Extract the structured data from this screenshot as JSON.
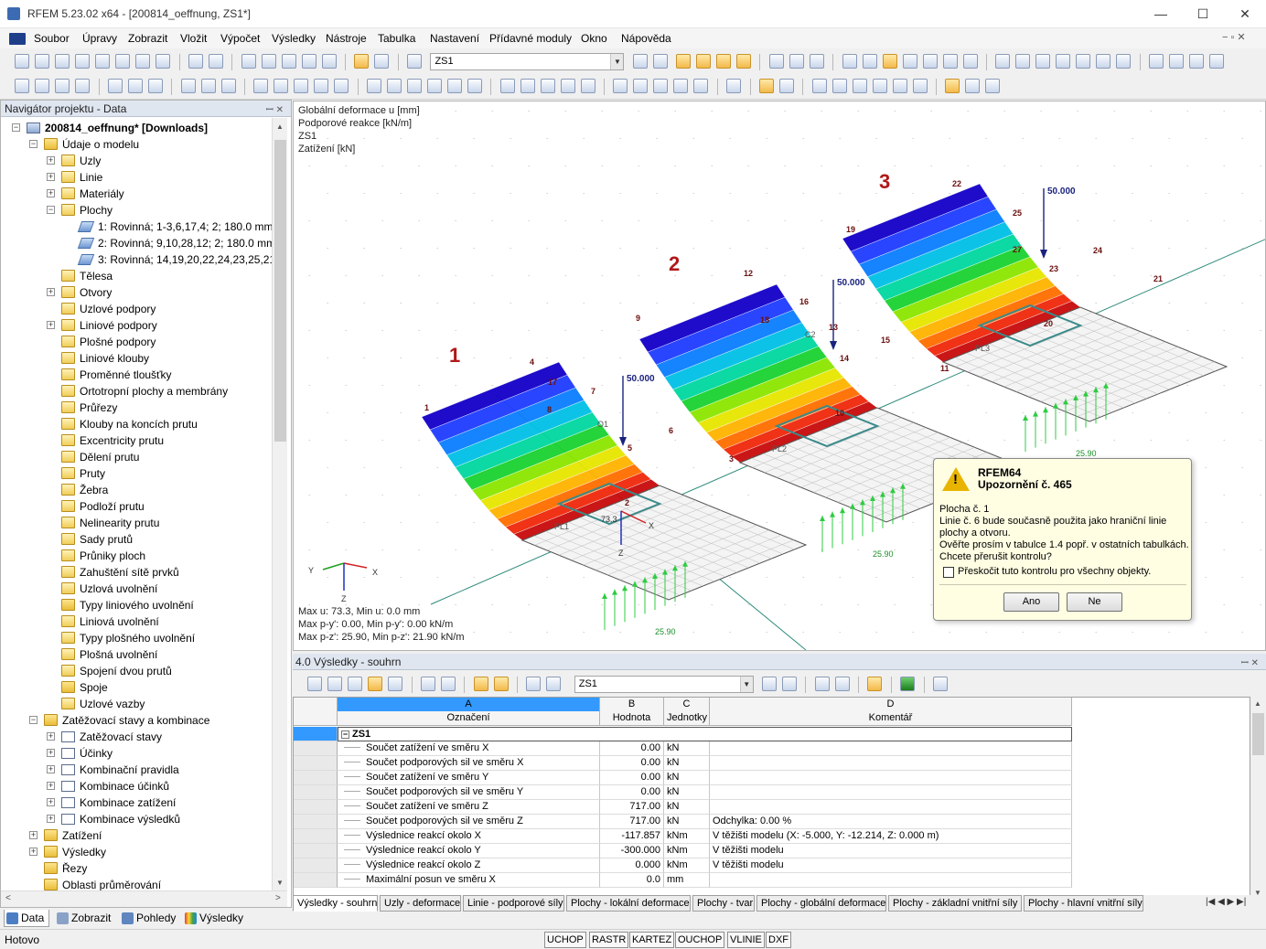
{
  "window": {
    "title": "RFEM 5.23.02 x64 - [200814_oeffnung, ZS1*]",
    "minimize": "—",
    "maximize": "☐",
    "close": "✕"
  },
  "menu": [
    "Soubor",
    "Úpravy",
    "Zobrazit",
    "Vložit",
    "Výpočet",
    "Výsledky",
    "Nástroje",
    "Tabulka",
    "Nastavení",
    "Přídavné moduly",
    "Okno",
    "Nápověda"
  ],
  "toolbar": {
    "loadcase": "ZS1"
  },
  "navigator": {
    "title": "Navigátor projektu - Data",
    "pin": "ꟷ ✕",
    "tree": [
      {
        "label": "200814_oeffnung* [Downloads]",
        "level": 0,
        "exp": "−",
        "icon": "project",
        "bold": true
      },
      {
        "label": "Údaje o modelu",
        "level": 1,
        "exp": "−",
        "icon": "folder"
      },
      {
        "label": "Uzly",
        "level": 2,
        "exp": "+",
        "icon": "item"
      },
      {
        "label": "Linie",
        "level": 2,
        "exp": "+",
        "icon": "item"
      },
      {
        "label": "Materiály",
        "level": 2,
        "exp": "+",
        "icon": "item"
      },
      {
        "label": "Plochy",
        "level": 2,
        "exp": "−",
        "icon": "item"
      },
      {
        "label": "1: Rovinná; 1-3,6,17,4; 2; 180.0 mm",
        "level": 3,
        "exp": "",
        "icon": "surface"
      },
      {
        "label": "2: Rovinná; 9,10,28,12; 2; 180.0 mm",
        "level": 3,
        "exp": "",
        "icon": "surface"
      },
      {
        "label": "3: Rovinná; 14,19,20,22,24,23,25,21; 2",
        "level": 3,
        "exp": "",
        "icon": "surface"
      },
      {
        "label": "Tělesa",
        "level": 2,
        "exp": "",
        "icon": "item"
      },
      {
        "label": "Otvory",
        "level": 2,
        "exp": "+",
        "icon": "item"
      },
      {
        "label": "Uzlové podpory",
        "level": 2,
        "exp": "",
        "icon": "item"
      },
      {
        "label": "Liniové podpory",
        "level": 2,
        "exp": "+",
        "icon": "item"
      },
      {
        "label": "Plošné podpory",
        "level": 2,
        "exp": "",
        "icon": "item"
      },
      {
        "label": "Liniové klouby",
        "level": 2,
        "exp": "",
        "icon": "item"
      },
      {
        "label": "Proměnné tloušťky",
        "level": 2,
        "exp": "",
        "icon": "item"
      },
      {
        "label": "Ortotropní plochy a membrány",
        "level": 2,
        "exp": "",
        "icon": "item"
      },
      {
        "label": "Průřezy",
        "level": 2,
        "exp": "",
        "icon": "item"
      },
      {
        "label": "Klouby na koncích prutu",
        "level": 2,
        "exp": "",
        "icon": "item"
      },
      {
        "label": "Excentricity prutu",
        "level": 2,
        "exp": "",
        "icon": "item"
      },
      {
        "label": "Dělení prutu",
        "level": 2,
        "exp": "",
        "icon": "item"
      },
      {
        "label": "Pruty",
        "level": 2,
        "exp": "",
        "icon": "item"
      },
      {
        "label": "Žebra",
        "level": 2,
        "exp": "",
        "icon": "item"
      },
      {
        "label": "Podloží prutu",
        "level": 2,
        "exp": "",
        "icon": "item"
      },
      {
        "label": "Nelinearity prutu",
        "level": 2,
        "exp": "",
        "icon": "item"
      },
      {
        "label": "Sady prutů",
        "level": 2,
        "exp": "",
        "icon": "item"
      },
      {
        "label": "Průniky ploch",
        "level": 2,
        "exp": "",
        "icon": "item"
      },
      {
        "label": "Zahuštění sítě prvků",
        "level": 2,
        "exp": "",
        "icon": "item"
      },
      {
        "label": "Uzlová uvolnění",
        "level": 2,
        "exp": "",
        "icon": "item"
      },
      {
        "label": "Typy liniového uvolnění",
        "level": 2,
        "exp": "",
        "icon": "folder"
      },
      {
        "label": "Liniová uvolnění",
        "level": 2,
        "exp": "",
        "icon": "item"
      },
      {
        "label": "Typy plošného uvolnění",
        "level": 2,
        "exp": "",
        "icon": "item"
      },
      {
        "label": "Plošná uvolnění",
        "level": 2,
        "exp": "",
        "icon": "item"
      },
      {
        "label": "Spojení dvou prutů",
        "level": 2,
        "exp": "",
        "icon": "item"
      },
      {
        "label": "Spoje",
        "level": 2,
        "exp": "",
        "icon": "folder"
      },
      {
        "label": "Uzlové vazby",
        "level": 2,
        "exp": "",
        "icon": "item"
      },
      {
        "label": "Zatěžovací stavy a kombinace",
        "level": 1,
        "exp": "−",
        "icon": "folder"
      },
      {
        "label": "Zatěžovací stavy",
        "level": 2,
        "exp": "+",
        "icon": "load"
      },
      {
        "label": "Účinky",
        "level": 2,
        "exp": "+",
        "icon": "load"
      },
      {
        "label": "Kombinační pravidla",
        "level": 2,
        "exp": "+",
        "icon": "load"
      },
      {
        "label": "Kombinace účinků",
        "level": 2,
        "exp": "+",
        "icon": "load"
      },
      {
        "label": "Kombinace zatížení",
        "level": 2,
        "exp": "+",
        "icon": "load"
      },
      {
        "label": "Kombinace výsledků",
        "level": 2,
        "exp": "+",
        "icon": "load"
      },
      {
        "label": "Zatížení",
        "level": 1,
        "exp": "+",
        "icon": "folder"
      },
      {
        "label": "Výsledky",
        "level": 1,
        "exp": "+",
        "icon": "folder"
      },
      {
        "label": "Řezy",
        "level": 1,
        "exp": "",
        "icon": "folder"
      },
      {
        "label": "Oblasti průměrování",
        "level": 1,
        "exp": "",
        "icon": "folder"
      }
    ],
    "tabs": [
      "Data",
      "Zobrazit",
      "Pohledy",
      "Výsledky"
    ]
  },
  "viewport": {
    "info_lines": [
      "Globální deformace u [mm]",
      "Podporové reakce [kN/m]",
      "ZS1",
      "Zatížení [kN]"
    ],
    "footer_lines": [
      "Max u: 73.3, Min u: 0.0 mm",
      "Max p-y': 0.00, Min p-y': 0.00 kN/m",
      "Max p-z': 25.90, Min p-z': 21.90 kN/m"
    ],
    "model_numbers": [
      "1",
      "2",
      "3"
    ],
    "load_label": "50.000",
    "reaction_label": "25.90",
    "max_label": "73.3",
    "axis_x": "X",
    "axis_y": "Y",
    "axis_z": "Z",
    "node_labels": [
      "1",
      "2",
      "3",
      "4",
      "5",
      "6",
      "7",
      "8",
      "9",
      "10",
      "11",
      "12",
      "13",
      "14",
      "15",
      "16",
      "17",
      "18",
      "19",
      "20",
      "21",
      "22",
      "23",
      "24",
      "25",
      "27"
    ],
    "surface_labels": [
      "PL1",
      "PL2",
      "PL3"
    ],
    "opening_labels": [
      "O1",
      "C2"
    ]
  },
  "dialog": {
    "app": "RFEM64",
    "title": "Upozornění č. 465",
    "line1": "Plocha č. 1",
    "line2": "Linie č. 6 bude současně použita jako hraniční linie",
    "line3": "plochy a otvoru.",
    "line4": "Ověřte prosím v tabulce 1.4 popř. v ostatních tabulkách.",
    "line5": "Chcete přerušit kontrolu?",
    "checkbox": "Přeskočit tuto kontrolu pro všechny objekty.",
    "yes": "Ano",
    "no": "Ne"
  },
  "results": {
    "title": "4.0 Výsledky - souhrn",
    "loadcase": "ZS1",
    "columns": {
      "letters": [
        "A",
        "B",
        "C",
        "D"
      ],
      "names": [
        "Označení",
        "Hodnota",
        "Jednotky",
        "Komentář"
      ]
    },
    "group": "ZS1",
    "rows": [
      [
        "Součet zatížení ve směru X",
        "0.00",
        "kN",
        ""
      ],
      [
        "Součet podporových sil ve směru X",
        "0.00",
        "kN",
        ""
      ],
      [
        "Součet zatížení ve směru Y",
        "0.00",
        "kN",
        ""
      ],
      [
        "Součet podporových sil ve směru Y",
        "0.00",
        "kN",
        ""
      ],
      [
        "Součet zatížení ve směru Z",
        "717.00",
        "kN",
        ""
      ],
      [
        "Součet podporových sil ve směru Z",
        "717.00",
        "kN",
        "Odchylka:  0.00 %"
      ],
      [
        "Výslednice reakcí okolo X",
        "-117.857",
        "kNm",
        "V těžišti modelu (X: -5.000, Y: -12.214, Z: 0.000 m)"
      ],
      [
        "Výslednice reakcí okolo Y",
        "-300.000",
        "kNm",
        "V těžišti modelu"
      ],
      [
        "Výslednice reakcí okolo Z",
        "0.000",
        "kNm",
        "V těžišti modelu"
      ],
      [
        "Maximální posun ve směru X",
        "0.0",
        "mm",
        ""
      ]
    ],
    "tabs": [
      "Výsledky - souhrn",
      "Uzly - deformace",
      "Linie - podporové síly",
      "Plochy - lokální deformace",
      "Plochy - tvar",
      "Plochy - globální deformace",
      "Plochy - základní vnitřní síly",
      "Plochy - hlavní vnitřní síly"
    ]
  },
  "status": {
    "text": "Hotovo",
    "buttons": [
      "UCHOP",
      "RASTR",
      "KARTEZ",
      "OUCHOP",
      "VLINIE",
      "DXF"
    ]
  },
  "colors": {
    "accent": "#3399ff",
    "model_number": "#b01818",
    "reaction": "#2ecc40",
    "load": "#1a237e"
  }
}
